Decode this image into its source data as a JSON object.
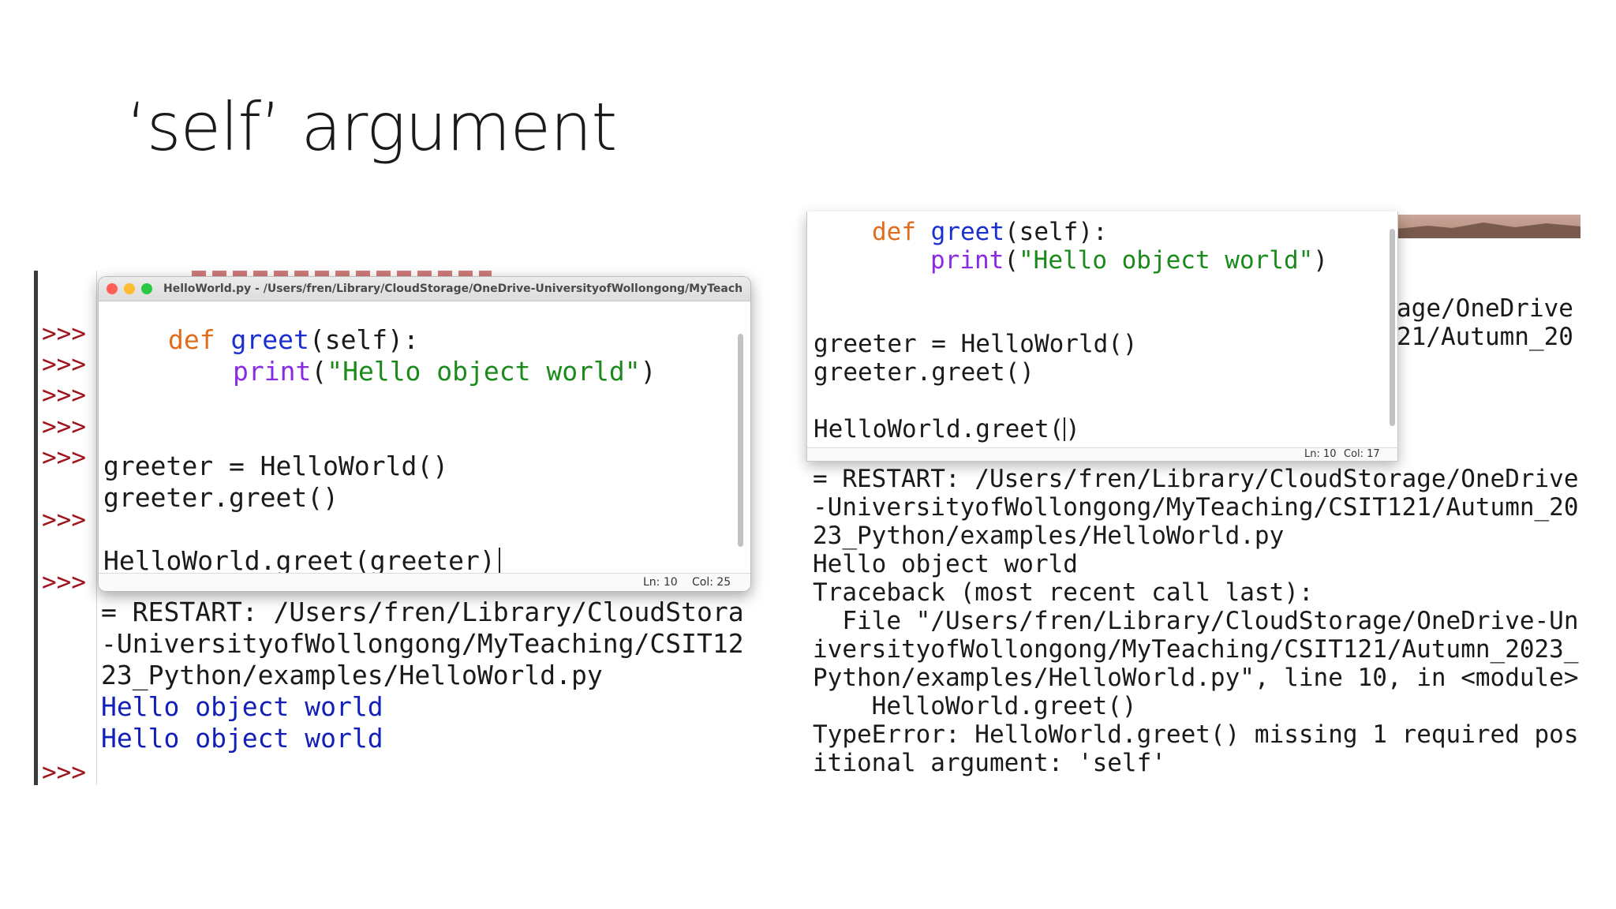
{
  "slide": {
    "title": "‘self’ argument"
  },
  "left": {
    "window_title": "HelloWorld.py - /Users/fren/Library/CloudStorage/OneDrive-UniversityofWollongong/MyTeaching/...",
    "prompt": ">>>",
    "code": {
      "def_kw": "def",
      "func_name": "greet",
      "params": "(self):",
      "print_kw": "print",
      "open_paren": "(",
      "string": "\"Hello object world\"",
      "close_paren": ")",
      "line_greeter": "greeter = HelloWorld()",
      "line_call": "greeter.greet()",
      "line_class_call": "HelloWorld.greet(greeter)"
    },
    "status": {
      "ln": "Ln: 10",
      "col": "Col: 25"
    },
    "output": {
      "restart_1": "= RESTART: /Users/fren/Library/CloudStora",
      "restart_2": "-UniversityofWollongong/MyTeaching/CSIT12",
      "restart_3": "23_Python/examples/HelloWorld.py",
      "hello_1": "Hello object world",
      "hello_2": "Hello object world"
    }
  },
  "right": {
    "code": {
      "def_kw": "def",
      "func_name": "greet",
      "params": "(self):",
      "print_kw": "print",
      "open_paren": "(",
      "string": "\"Hello object world\"",
      "close_paren": ")",
      "line_greeter": "greeter = HelloWorld()",
      "line_call": "greeter.greet()",
      "line_class_call_open": "HelloWorld.greet(",
      "line_class_call_close": ")"
    },
    "status": {
      "ln": "Ln: 10",
      "col": "Col: 17"
    },
    "behind": {
      "line_1": "age/OneDrive",
      "line_2": "21/Autumn_20"
    },
    "output": {
      "restart_1": "= RESTART: /Users/fren/Library/CloudStorage/OneDrive",
      "restart_2": "-UniversityofWollongong/MyTeaching/CSIT121/Autumn_20",
      "restart_3": "23_Python/examples/HelloWorld.py",
      "hello": "Hello object world",
      "traceback": "Traceback (most recent call last):",
      "file_1": "  File \"/Users/fren/Library/CloudStorage/OneDrive-Un",
      "file_2": "iversityofWollongong/MyTeaching/CSIT121/Autumn_2023_",
      "file_3": "Python/examples/HelloWorld.py\", line 10, in <module>",
      "code_line": "    HelloWorld.greet()",
      "error_1": "TypeError: HelloWorld.greet() missing 1 required pos",
      "error_2": "itional argument: 'self'"
    }
  }
}
